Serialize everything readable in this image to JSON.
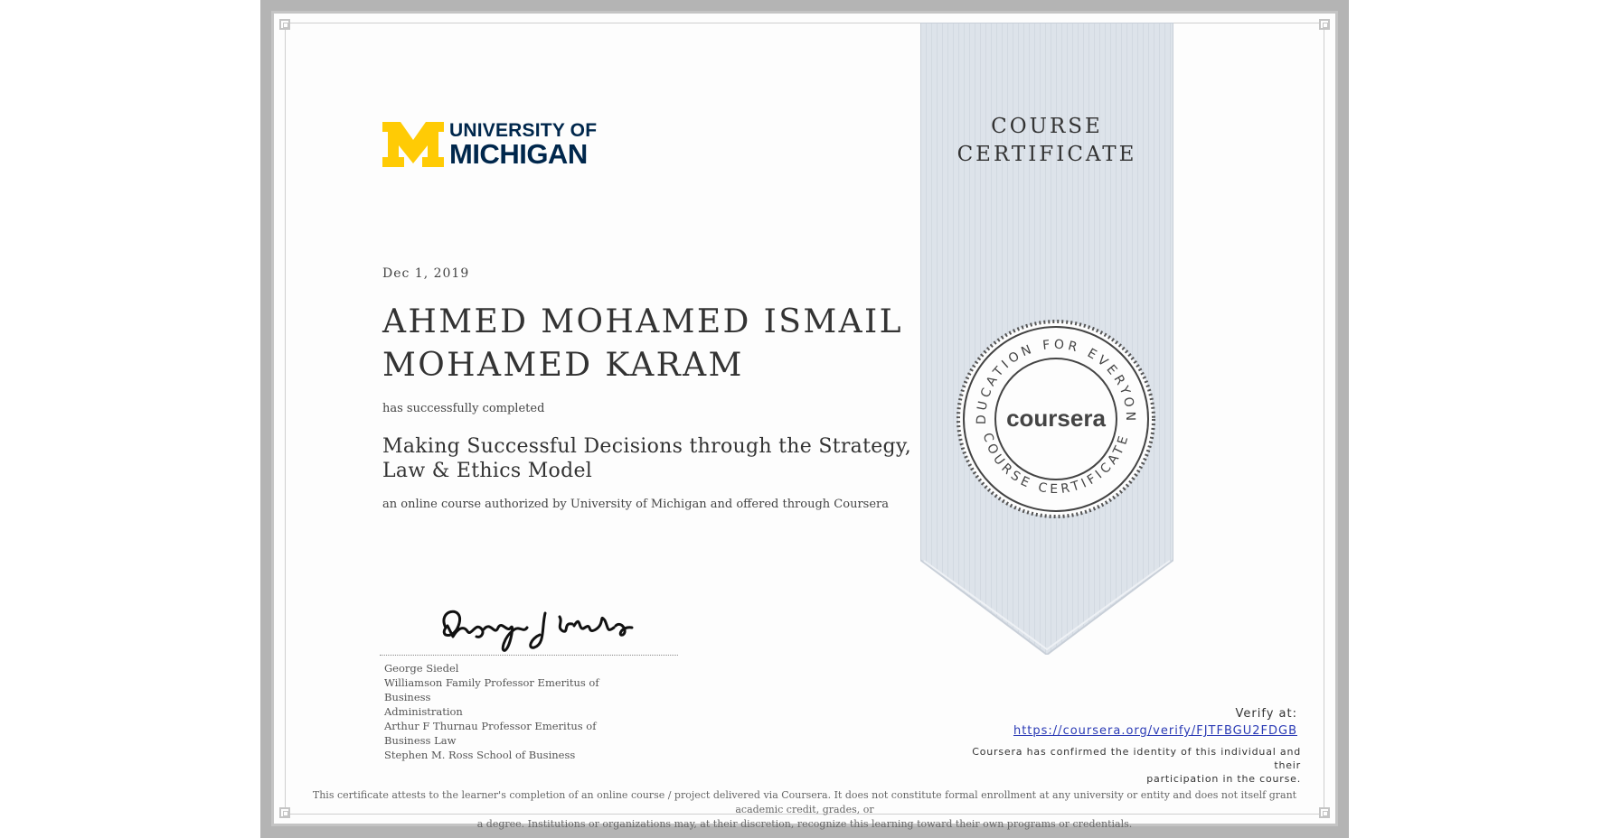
{
  "logo": {
    "line1": "UNIVERSITY OF",
    "line2": "MICHIGAN",
    "colors": {
      "maize": "#FFCB05",
      "blue": "#00274C"
    }
  },
  "certificate": {
    "date": "Dec 1, 2019",
    "name_line1": "AHMED MOHAMED ISMAIL",
    "name_line2": "MOHAMED KARAM",
    "completed_text": "has successfully completed",
    "course_line1": "Making Successful Decisions through the Strategy,",
    "course_line2": "Law & Ethics Model",
    "authorized_text": "an online course authorized by University of Michigan and offered through Coursera"
  },
  "ribbon": {
    "line1": "COURSE",
    "line2": "CERTIFICATE"
  },
  "seal": {
    "brand": "coursera",
    "top_text": "EDUCATION FOR EVERYONE",
    "bottom_text": "COURSE CERTIFICATE"
  },
  "signer": {
    "signature_text": "George J Siedel",
    "name": "George Siedel",
    "title1": "Williamson Family Professor Emeritus of Business",
    "title2": "Administration",
    "title3": "Arthur F Thurnau Professor Emeritus of Business Law",
    "title4": "Stephen M. Ross School of Business"
  },
  "verify": {
    "label": "Verify at:",
    "url": "https://coursera.org/verify/FJTFBGU2FDGB",
    "confirm_line1": "Coursera has confirmed the identity of this individual and their",
    "confirm_line2": "participation in the course."
  },
  "disclaimer": {
    "line1": "This certificate attests to the learner's completion of an online course / project delivered via Coursera. It does not constitute formal enrollment at any university or entity and does not itself grant academic credit, grades, or",
    "line2": "a degree. Institutions or organizations may, at their discretion, recognize this learning toward their own programs or credentials."
  }
}
